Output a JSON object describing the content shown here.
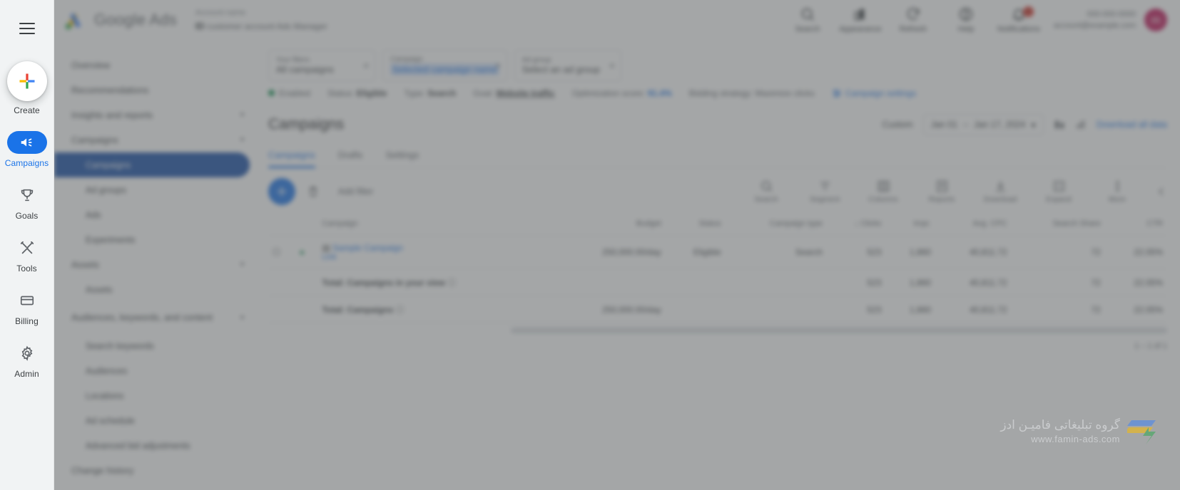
{
  "rail": {
    "menu_icon": "hamburger-menu-icon",
    "create": {
      "label": "Create",
      "icon": "plus-icon"
    },
    "items": [
      {
        "label": "Campaigns",
        "icon": "campaign-megaphone-icon",
        "active": true
      },
      {
        "label": "Goals",
        "icon": "trophy-icon",
        "active": false
      },
      {
        "label": "Tools",
        "icon": "tools-hammer-wrench-icon",
        "active": false
      },
      {
        "label": "Billing",
        "icon": "credit-card-icon",
        "active": false
      },
      {
        "label": "Admin",
        "icon": "gear-icon",
        "active": false
      }
    ]
  },
  "header": {
    "product": "Google",
    "product2": "Ads",
    "logo_icon": "google-ads-logo-icon",
    "account": {
      "line1": "Account name",
      "line2": "ID",
      "line3": "customer account",
      "line4": "Ads Manager"
    },
    "tools": [
      {
        "label": "Search",
        "icon": "search-icon"
      },
      {
        "label": "Appearance",
        "icon": "appearance-icon"
      },
      {
        "label": "Refresh",
        "icon": "refresh-icon"
      },
      {
        "label": "Help",
        "icon": "help-circle-icon"
      },
      {
        "label": "Notifications",
        "icon": "bell-icon",
        "badge": "!"
      }
    ],
    "account_right_line1": "000-000-0000",
    "account_right_line2": "account@example.com",
    "avatar_initial": "m",
    "avatar_color": "#c2185b"
  },
  "subnav": {
    "items": [
      {
        "label": "Overview",
        "level": 0,
        "expand": false,
        "selected": false
      },
      {
        "label": "Recommendations",
        "level": 0,
        "expand": false,
        "selected": false
      },
      {
        "label": "Insights and reports",
        "level": 0,
        "expand": true,
        "selected": false
      },
      {
        "label": "Campaigns",
        "level": 0,
        "expand": true,
        "selected": false
      },
      {
        "label": "Campaigns",
        "level": 1,
        "expand": false,
        "selected": true
      },
      {
        "label": "Ad groups",
        "level": 1,
        "expand": false,
        "selected": false
      },
      {
        "label": "Ads",
        "level": 1,
        "expand": false,
        "selected": false
      },
      {
        "label": "Experiments",
        "level": 1,
        "expand": false,
        "selected": false
      },
      {
        "label": "Assets",
        "level": 0,
        "expand": true,
        "selected": false
      },
      {
        "label": "Assets",
        "level": 1,
        "expand": false,
        "selected": false
      },
      {
        "label": "Audiences, keywords, and content",
        "level": 0,
        "expand": true,
        "selected": false
      },
      {
        "label": "Search keywords",
        "level": 1,
        "expand": false,
        "selected": false
      },
      {
        "label": "Audiences",
        "level": 1,
        "expand": false,
        "selected": false
      },
      {
        "label": "Locations",
        "level": 1,
        "expand": false,
        "selected": false
      },
      {
        "label": "Ad schedule",
        "level": 1,
        "expand": false,
        "selected": false
      },
      {
        "label": "Advanced bid adjustments",
        "level": 1,
        "expand": false,
        "selected": false
      },
      {
        "label": "Change history",
        "level": 0,
        "expand": false,
        "selected": false
      }
    ]
  },
  "filters": {
    "chips": [
      {
        "label": "Your filters",
        "value": "All campaigns",
        "icon": "filter-icon",
        "highlight": false,
        "closable": true
      },
      {
        "label": "Campaign",
        "value": "Selected campaign name",
        "icon": "campaign-icon",
        "highlight": true,
        "closable": true
      },
      {
        "label": "Ad group",
        "value": "Select an ad group",
        "icon": "",
        "highlight": false,
        "closable": true
      }
    ],
    "status": {
      "state": "Enabled",
      "status_label": "Status:",
      "status_value": "Eligible",
      "type_label": "Type:",
      "type_value": "Search",
      "goal_label": "Goal:",
      "goal_value": "Website traffic",
      "optimization_label": "Optimization score:",
      "optimization_value": "91.4%",
      "bidding": "Bidding strategy: Maximize clicks",
      "settings_link": "Campaign settings",
      "settings_icon": "settings-slider-icon"
    }
  },
  "main": {
    "page_title": "Campaigns",
    "date": {
      "custom_label": "Custom",
      "from": "Jan 01",
      "dash": "–",
      "to": "Jan 17, 2024",
      "chevron": "▾",
      "compare_icon": "compare-icon",
      "chart_icon": "chart-bar-icon",
      "report_link": "Download all data"
    },
    "tabs": [
      {
        "label": "Campaigns",
        "active": true
      },
      {
        "label": "Drafts",
        "active": false
      },
      {
        "label": "Settings",
        "active": false
      }
    ],
    "toolbar": {
      "primary_icon": "add-circle-icon",
      "delete_icon": "trash-icon",
      "filter_label": "Add filter",
      "actions": [
        {
          "label": "Search",
          "icon": "search-icon"
        },
        {
          "label": "Segment",
          "icon": "segment-icon"
        },
        {
          "label": "Columns",
          "icon": "columns-icon"
        },
        {
          "label": "Reports",
          "icon": "report-icon"
        },
        {
          "label": "Download",
          "icon": "download-icon"
        },
        {
          "label": "Expand",
          "icon": "expand-icon"
        },
        {
          "label": "More",
          "icon": "more-vertical-icon"
        }
      ],
      "collapse_icon": "collapse-icon"
    },
    "table": {
      "headers": [
        "",
        "",
        "Campaign",
        "Budget",
        "Status",
        "Campaign type",
        "↓ Clicks",
        "Impr.",
        "Avg. CPC",
        "Search Share",
        "CTR"
      ],
      "rows": [
        {
          "kind": "campaign",
          "state_dot": "#0d904f",
          "type_icon": "search-campaign-icon",
          "name": "Sample Campaign",
          "subname": "Link",
          "budget": "250,000.00/day",
          "status": "Eligible",
          "campaign_type": "Search",
          "clicks": "523",
          "impr": "1,860",
          "avg_cpc": "40,811.72",
          "search_share": "72",
          "ctr": "22.05%"
        },
        {
          "kind": "total",
          "name": "Total: Campaigns in your view",
          "budget": "",
          "status": "",
          "campaign_type": "",
          "clicks": "523",
          "impr": "1,860",
          "avg_cpc": "40,811.72",
          "search_share": "72",
          "ctr": "22.05%"
        },
        {
          "kind": "total",
          "name": "Total: Campaigns",
          "budget": "250,000.00/day",
          "status": "",
          "campaign_type": "",
          "clicks": "523",
          "impr": "1,860",
          "avg_cpc": "40,811.72",
          "search_share": "72",
          "ctr": "22.05%"
        }
      ],
      "pager": "1 – 1 of 1"
    }
  },
  "watermark": {
    "persian": "گروه تبلیغاتی فامیـن ادز",
    "url": "www.famin-ads.com",
    "logo_icon": "famin-ads-logo-icon"
  }
}
